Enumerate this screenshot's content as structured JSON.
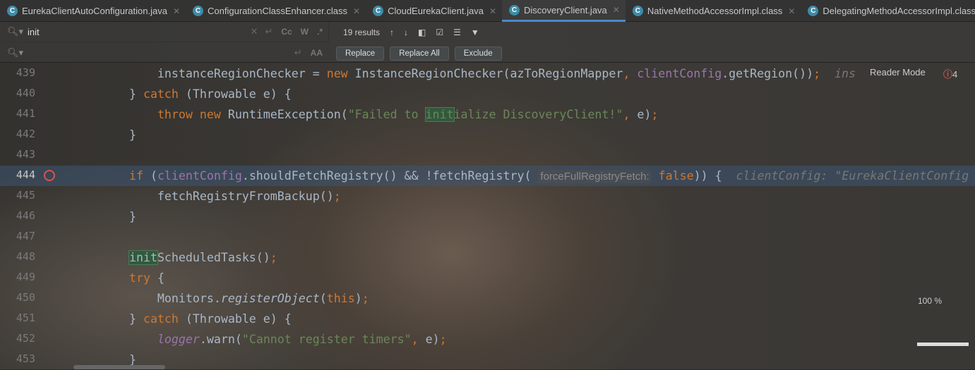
{
  "tabs": [
    {
      "label": "EurekaClientAutoConfiguration.java",
      "active": false
    },
    {
      "label": "ConfigurationClassEnhancer.class",
      "active": false
    },
    {
      "label": "CloudEurekaClient.java",
      "active": false
    },
    {
      "label": "DiscoveryClient.java",
      "active": true
    },
    {
      "label": "NativeMethodAccessorImpl.class",
      "active": false
    },
    {
      "label": "DelegatingMethodAccessorImpl.class",
      "active": false
    }
  ],
  "find": {
    "search_value": "init",
    "replace_value": "",
    "results": "19 results",
    "opt_case": "Cc",
    "opt_word": "W",
    "opt_regex": ".*",
    "opt_preserve": "AA",
    "replace": "Replace",
    "replace_all": "Replace All",
    "exclude": "Exclude"
  },
  "editor": {
    "reader_mode": "Reader Mode",
    "error_count": "4",
    "zoom": "100 %",
    "current_line": "444",
    "lines": [
      {
        "n": "439",
        "tokens": [
          [
            "        instanceRegionChecker = ",
            ""
          ],
          [
            "new",
            "kw"
          ],
          [
            " InstanceRegionChecker(azToRegionMapper",
            ""
          ],
          [
            ", ",
            "kw"
          ],
          [
            "clientConfig",
            "fd"
          ],
          [
            ".getRegion())",
            ""
          ],
          [
            ";",
            "kw"
          ],
          [
            "  ins",
            "inl"
          ]
        ]
      },
      {
        "n": "440",
        "tokens": [
          [
            "    } ",
            ""
          ],
          [
            "catch",
            "kw"
          ],
          [
            " (Throwable e) {",
            ""
          ]
        ]
      },
      {
        "n": "441",
        "tokens": [
          [
            "        ",
            ""
          ],
          [
            "throw new",
            "kw"
          ],
          [
            " RuntimeException(",
            ""
          ],
          [
            "\"Failed to ",
            "st"
          ],
          [
            "init",
            "st hl"
          ],
          [
            "ialize DiscoveryClient!\"",
            "st"
          ],
          [
            ", ",
            "kw"
          ],
          [
            "e)",
            ""
          ],
          [
            ";",
            "kw"
          ]
        ]
      },
      {
        "n": "442",
        "tokens": [
          [
            "    }",
            ""
          ]
        ]
      },
      {
        "n": "443",
        "tokens": []
      },
      {
        "n": "444",
        "tokens": [
          [
            "    ",
            ""
          ],
          [
            "if",
            "kw"
          ],
          [
            " (",
            ""
          ],
          [
            "clientConfig",
            "fd"
          ],
          [
            ".shouldFetchRegistry() && !fetchRegistry( ",
            ""
          ],
          [
            "forceFullRegistryFetch:",
            "hint"
          ],
          [
            " ",
            ""
          ],
          [
            "false",
            "kw"
          ],
          [
            ")) {",
            ""
          ],
          [
            "  clientConfig: \"EurekaClientConfig",
            "inl"
          ]
        ]
      },
      {
        "n": "445",
        "tokens": [
          [
            "        fetchRegistryFromBackup()",
            ""
          ],
          [
            ";",
            "kw"
          ]
        ]
      },
      {
        "n": "446",
        "tokens": [
          [
            "    }",
            ""
          ]
        ]
      },
      {
        "n": "447",
        "tokens": []
      },
      {
        "n": "448",
        "tokens": [
          [
            "    ",
            ""
          ],
          [
            "init",
            "hl"
          ],
          [
            "ScheduledTasks()",
            ""
          ],
          [
            ";",
            "kw"
          ]
        ]
      },
      {
        "n": "449",
        "tokens": [
          [
            "    ",
            ""
          ],
          [
            "try",
            "kw"
          ],
          [
            " {",
            ""
          ]
        ]
      },
      {
        "n": "450",
        "tokens": [
          [
            "        Monitors.",
            ""
          ],
          [
            "registerObject",
            "it"
          ],
          [
            "(",
            ""
          ],
          [
            "this",
            "kw"
          ],
          [
            ")",
            ""
          ],
          [
            ";",
            "kw"
          ]
        ]
      },
      {
        "n": "451",
        "tokens": [
          [
            "    } ",
            ""
          ],
          [
            "catch",
            "kw"
          ],
          [
            " (Throwable e) {",
            ""
          ]
        ]
      },
      {
        "n": "452",
        "tokens": [
          [
            "        ",
            ""
          ],
          [
            "logger",
            "sf"
          ],
          [
            ".warn(",
            ""
          ],
          [
            "\"Cannot register timers\"",
            "st"
          ],
          [
            ", ",
            "kw"
          ],
          [
            "e)",
            ""
          ],
          [
            ";",
            "kw"
          ]
        ]
      },
      {
        "n": "453",
        "tokens": [
          [
            "    }",
            ""
          ]
        ]
      }
    ]
  }
}
